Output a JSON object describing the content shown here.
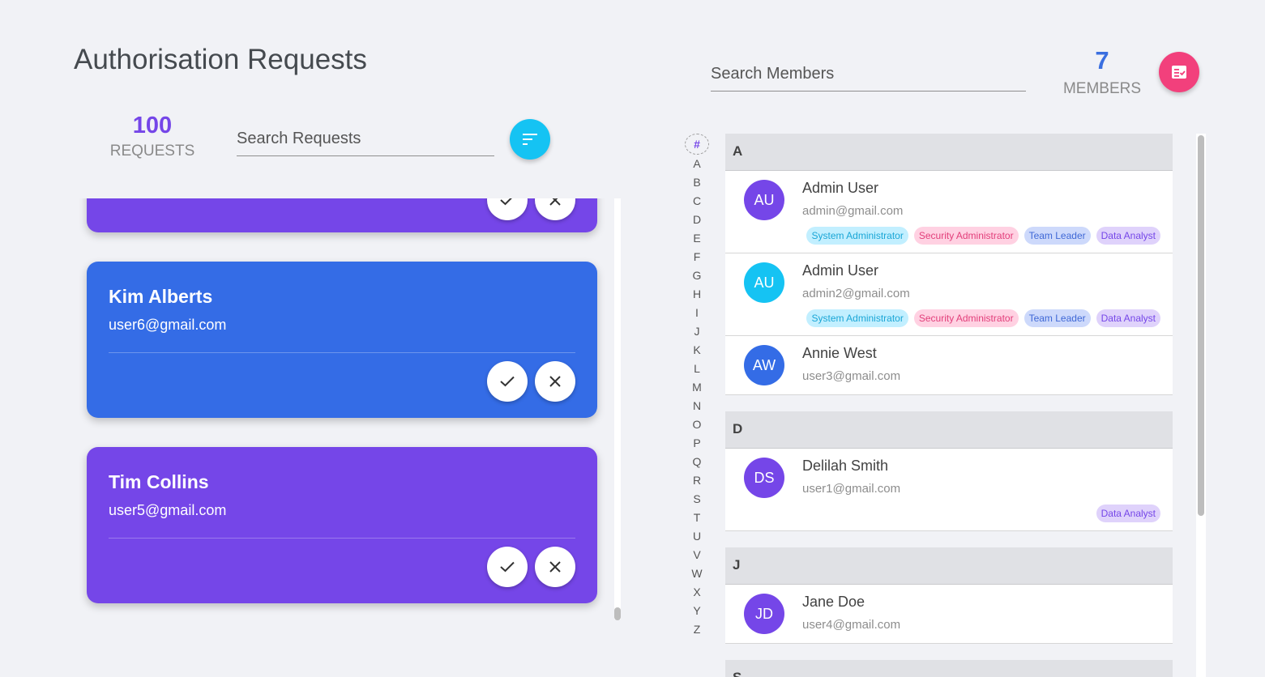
{
  "page": {
    "title": "Authorisation Requests"
  },
  "requests": {
    "count": "100",
    "count_label": "REQUESTS",
    "search_placeholder": "Search Requests",
    "filter_icon": "sort-lines-icon",
    "cards": [
      {
        "name": "",
        "email": "",
        "color": "#7546e8"
      },
      {
        "name": "Kim Alberts",
        "email": "user6@gmail.com",
        "color": "#346ce6"
      },
      {
        "name": "Tim Collins",
        "email": "user5@gmail.com",
        "color": "#7546e8"
      }
    ],
    "approve_icon": "check-icon",
    "reject_icon": "close-icon"
  },
  "members": {
    "search_placeholder": "Search Members",
    "count": "7",
    "count_label": "MEMBERS",
    "action_icon": "checklist-icon",
    "index_hash": "#",
    "index_letters": [
      "A",
      "B",
      "C",
      "D",
      "E",
      "F",
      "G",
      "H",
      "I",
      "J",
      "K",
      "L",
      "M",
      "N",
      "O",
      "P",
      "Q",
      "R",
      "S",
      "T",
      "U",
      "V",
      "W",
      "X",
      "Y",
      "Z"
    ],
    "sections": [
      {
        "letter": "A",
        "items": [
          {
            "initials": "AU",
            "name": "Admin User",
            "email": "admin@gmail.com",
            "avatar_color": "#7546e8",
            "roles": [
              "System Administrator",
              "Security Administrator",
              "Team Leader",
              "Data Analyst"
            ]
          },
          {
            "initials": "AU",
            "name": "Admin User",
            "email": "admin2@gmail.com",
            "avatar_color": "#15c3f3",
            "roles": [
              "System Administrator",
              "Security Administrator",
              "Team Leader",
              "Data Analyst"
            ]
          },
          {
            "initials": "AW",
            "name": "Annie West",
            "email": "user3@gmail.com",
            "avatar_color": "#346ce6",
            "roles": []
          }
        ]
      },
      {
        "letter": "D",
        "items": [
          {
            "initials": "DS",
            "name": "Delilah Smith",
            "email": "user1@gmail.com",
            "avatar_color": "#7546e8",
            "roles": [
              "Data Analyst"
            ]
          }
        ]
      },
      {
        "letter": "J",
        "items": [
          {
            "initials": "JD",
            "name": "Jane Doe",
            "email": "user4@gmail.com",
            "avatar_color": "#7546e8",
            "roles": []
          }
        ]
      },
      {
        "letter": "S",
        "items": []
      }
    ],
    "role_colors": {
      "System Administrator": {
        "bg": "#c2efff",
        "fg": "#1aa6d6"
      },
      "Security Administrator": {
        "bg": "#ffd1e2",
        "fg": "#e23e7a"
      },
      "Team Leader": {
        "bg": "#cdd9fb",
        "fg": "#3f68d6"
      },
      "Data Analyst": {
        "bg": "#dfd2fb",
        "fg": "#7546e8"
      }
    }
  }
}
